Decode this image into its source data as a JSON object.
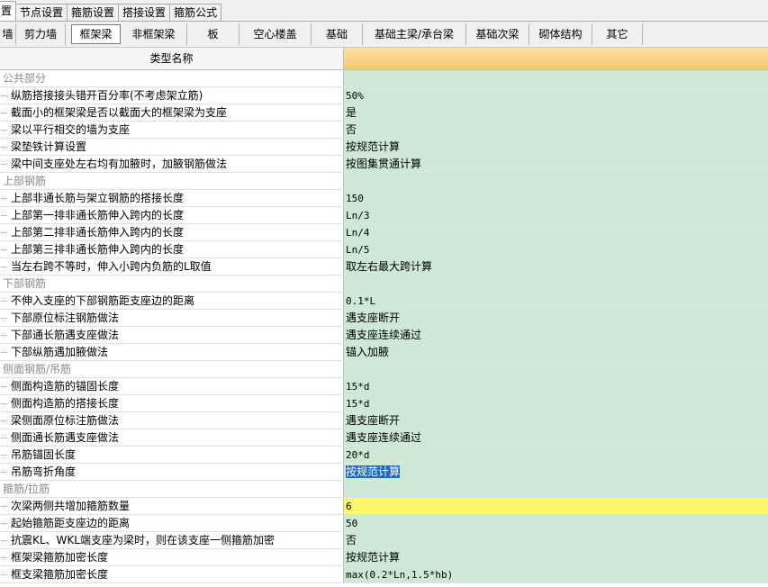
{
  "tabs": [
    {
      "label": "置",
      "active": false
    },
    {
      "label": "节点设置",
      "active": false
    },
    {
      "label": "箍筋设置",
      "active": false
    },
    {
      "label": "搭接设置",
      "active": false
    },
    {
      "label": "箍筋公式",
      "active": false
    }
  ],
  "categories": [
    {
      "label": "墙"
    },
    {
      "label": "剪力墙"
    },
    {
      "label": "框架梁"
    },
    {
      "label": "非框架梁"
    },
    {
      "label": "板"
    },
    {
      "label": "空心楼盖"
    },
    {
      "label": "基础"
    },
    {
      "label": "基础主梁/承台梁"
    },
    {
      "label": "基础次梁"
    },
    {
      "label": "砌体结构"
    },
    {
      "label": "其它"
    }
  ],
  "table": {
    "header": {
      "name": "类型名称",
      "value": ""
    },
    "rows": [
      {
        "type": "group",
        "name": "公共部分",
        "value": ""
      },
      {
        "type": "item",
        "name": "纵筋搭接接头错开百分率(不考虑架立筋)",
        "value": "50%"
      },
      {
        "type": "item",
        "name": "截面小的框架梁是否以截面大的框架梁为支座",
        "value": "是"
      },
      {
        "type": "item",
        "name": "梁以平行相交的墙为支座",
        "value": "否"
      },
      {
        "type": "item",
        "name": "梁垫铁计算设置",
        "value": "按规范计算"
      },
      {
        "type": "item",
        "name": "梁中间支座处左右均有加腋时，加腋钢筋做法",
        "value": "按图集贯通计算"
      },
      {
        "type": "group",
        "name": "上部钢筋",
        "value": ""
      },
      {
        "type": "item",
        "name": "上部非通长筋与架立钢筋的搭接长度",
        "value": "150"
      },
      {
        "type": "item",
        "name": "上部第一排非通长筋伸入跨内的长度",
        "value": "Ln/3"
      },
      {
        "type": "item",
        "name": "上部第二排非通长筋伸入跨内的长度",
        "value": "Ln/4"
      },
      {
        "type": "item",
        "name": "上部第三排非通长筋伸入跨内的长度",
        "value": "Ln/5"
      },
      {
        "type": "item",
        "name": "当左右跨不等时，伸入小跨内负筋的L取值",
        "value": "取左右最大跨计算"
      },
      {
        "type": "group",
        "name": "下部钢筋",
        "value": ""
      },
      {
        "type": "item",
        "name": "不伸入支座的下部钢筋距支座边的距离",
        "value": "0.1*L"
      },
      {
        "type": "item",
        "name": "下部原位标注钢筋做法",
        "value": "遇支座断开"
      },
      {
        "type": "item",
        "name": "下部通长筋遇支座做法",
        "value": "遇支座连续通过"
      },
      {
        "type": "item",
        "name": "下部纵筋遇加腋做法",
        "value": "锚入加腋"
      },
      {
        "type": "group",
        "name": "侧面钢筋/吊筋",
        "value": ""
      },
      {
        "type": "item",
        "name": "侧面构造筋的锚固长度",
        "value": "15*d"
      },
      {
        "type": "item",
        "name": "侧面构造筋的搭接长度",
        "value": "15*d"
      },
      {
        "type": "item",
        "name": "梁侧面原位标注筋做法",
        "value": "遇支座断开"
      },
      {
        "type": "item",
        "name": "侧面通长筋遇支座做法",
        "value": "遇支座连续通过"
      },
      {
        "type": "item",
        "name": "吊筋锚固长度",
        "value": "20*d"
      },
      {
        "type": "item",
        "name": "吊筋弯折角度",
        "value": "按规范计算",
        "selected": true
      },
      {
        "type": "group",
        "name": "箍筋/拉筋",
        "value": ""
      },
      {
        "type": "item",
        "name": "次梁两侧共增加箍筋数量",
        "value": "6",
        "highlight": true
      },
      {
        "type": "item",
        "name": "起始箍筋距支座边的距离",
        "value": "50"
      },
      {
        "type": "item",
        "name": "抗震KL、WKL端支座为梁时，则在该支座一侧箍筋加密",
        "value": "否"
      },
      {
        "type": "item",
        "name": "框架梁箍筋加密长度",
        "value": "按规范计算"
      },
      {
        "type": "item",
        "name": "框支梁箍筋加密长度",
        "value": "max(0.2*Ln,1.5*hb)"
      }
    ]
  }
}
